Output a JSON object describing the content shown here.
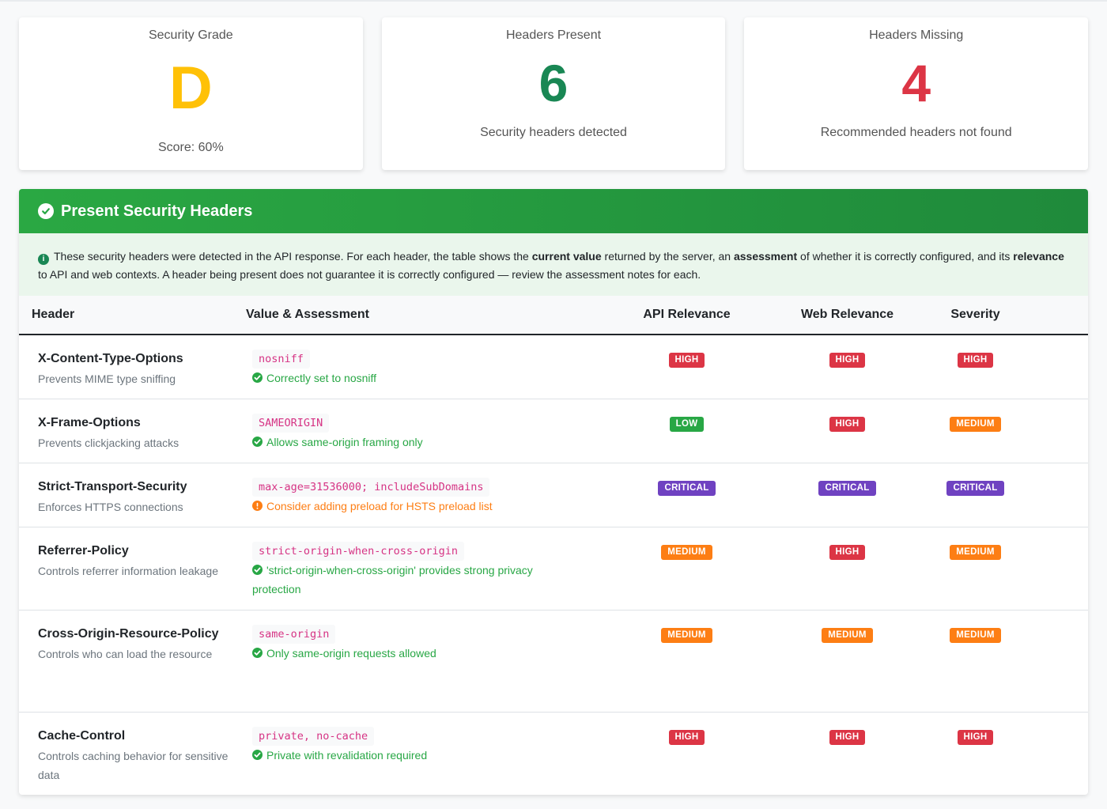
{
  "cards": {
    "grade": {
      "title": "Security Grade",
      "value": "D",
      "score": "Score: 60%"
    },
    "present": {
      "title": "Headers Present",
      "value": "6",
      "subtitle": "Security headers detected"
    },
    "missing": {
      "title": "Headers Missing",
      "value": "4",
      "subtitle": "Recommended headers not found"
    }
  },
  "panel": {
    "title": "Present Security Headers",
    "info": {
      "t1": "These security headers were detected in the API response. For each header, the table shows the ",
      "b1": "current value",
      "t2": " returned by the server, an ",
      "b2": "assessment",
      "t3": " of whether it is correctly configured, and its ",
      "b3": "relevance",
      "t4": " to API and web contexts. A header being present does not guarantee it is correctly configured — review the assessment notes for each."
    },
    "columns": {
      "header": "Header",
      "value": "Value & Assessment",
      "api": "API Relevance",
      "web": "Web Relevance",
      "severity": "Severity"
    },
    "rows": [
      {
        "name": "X-Content-Type-Options",
        "desc": "Prevents MIME type sniffing",
        "value": "nosniff",
        "assessment": "Correctly set to nosniff",
        "status": "ok",
        "api": "HIGH",
        "web": "HIGH",
        "severity": "HIGH"
      },
      {
        "name": "X-Frame-Options",
        "desc": "Prevents clickjacking attacks",
        "value": "SAMEORIGIN",
        "assessment": "Allows same-origin framing only",
        "status": "ok",
        "api": "LOW",
        "web": "HIGH",
        "severity": "MEDIUM"
      },
      {
        "name": "Strict-Transport-Security",
        "desc": "Enforces HTTPS connections",
        "value": "max-age=31536000; includeSubDomains",
        "assessment": "Consider adding preload for HSTS preload list",
        "status": "warn",
        "api": "CRITICAL",
        "web": "CRITICAL",
        "severity": "CRITICAL"
      },
      {
        "name": "Referrer-Policy",
        "desc": "Controls referrer information leakage",
        "value": "strict-origin-when-cross-origin",
        "assessment": "'strict-origin-when-cross-origin' provides strong privacy protection",
        "status": "ok",
        "api": "MEDIUM",
        "web": "HIGH",
        "severity": "MEDIUM"
      },
      {
        "name": "Cross-Origin-Resource-Policy",
        "desc": "Controls who can load the resource",
        "value": "same-origin",
        "assessment": "Only same-origin requests allowed",
        "status": "ok",
        "api": "MEDIUM",
        "web": "MEDIUM",
        "severity": "MEDIUM"
      },
      {
        "name": "Cache-Control",
        "desc": "Controls caching behavior for sensitive data",
        "value": "private, no-cache",
        "assessment": "Private with revalidation required",
        "status": "ok",
        "api": "HIGH",
        "web": "HIGH",
        "severity": "HIGH"
      }
    ]
  }
}
